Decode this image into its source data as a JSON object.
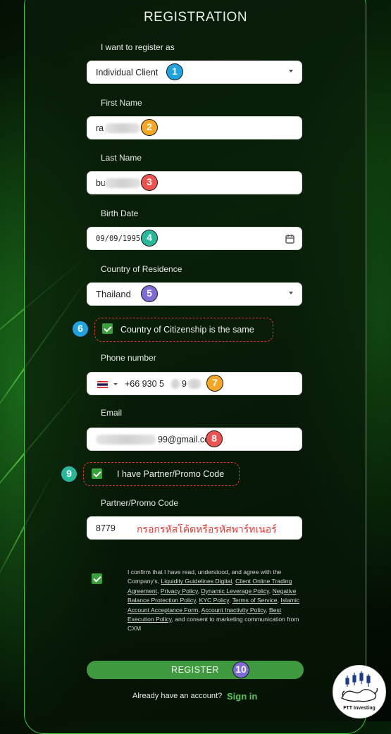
{
  "form": {
    "title": "REGISTRATION",
    "register_as": {
      "label": "I want to register as",
      "value": "Individual Client"
    },
    "first_name": {
      "label": "First Name",
      "value": "ra"
    },
    "last_name": {
      "label": "Last Name",
      "value": "bu"
    },
    "birth_date": {
      "label": "Birth Date",
      "value": "09/09/1995"
    },
    "country": {
      "label": "Country of Residence",
      "value": "Thailand"
    },
    "citizenship_same": {
      "label": "Country of Citizenship is the same",
      "checked": true
    },
    "phone": {
      "label": "Phone number",
      "value": "+66 930 5",
      "value_tail": "9"
    },
    "email": {
      "label": "Email",
      "value": "99@gmail.com"
    },
    "promo_toggle": {
      "label": "I have Partner/Promo Code",
      "checked": true
    },
    "promo": {
      "label": "Partner/Promo Code",
      "value": "8779",
      "hint": "กรอกรหัสโค้ดหรือรหัสพาร์ทเนอร์"
    },
    "consent": {
      "checked": true,
      "t1": "I confirm that I have read, understood, and agree with the Company's, ",
      "l1": "Liquidity Guidelines Digital",
      "s1": ", ",
      "l2": "Client Online Trading Agreement",
      "s2": ", ",
      "l3": "Privacy Policy",
      "s3": ", ",
      "l4": "Dynamic Leverage Policy",
      "s4": ", ",
      "l5": "Negative Balance Protection Policy",
      "s5": ", ",
      "l6": "KYC Policy",
      "s6": ", ",
      "l7": "Terms of Service",
      "s7": ", ",
      "l8": "Islamic Account Acceptance Form",
      "s8": ", ",
      "l9": "Account Inactivity Policy",
      "s9": ", ",
      "l10": "Best Execution Policy",
      "t2": ", and consent to marketing communication from CXM"
    },
    "register_button": "REGISTER",
    "already_text": "Already have an account?",
    "sign_in": "Sign in"
  },
  "badges": {
    "b1": "1",
    "b2": "2",
    "b3": "3",
    "b4": "4",
    "b5": "5",
    "b6": "6",
    "b7": "7",
    "b8": "8",
    "b9": "9",
    "b10": "10"
  },
  "colors": {
    "accent": "#3aa13a",
    "badge_blue": "#1fa3e0",
    "badge_orange": "#f5a623",
    "badge_red": "#ef5350",
    "badge_teal": "#26b99a",
    "badge_purple": "#7e6bd6",
    "hint_red": "#e53935"
  },
  "icons": [
    "calendar-icon",
    "thai-flag-icon",
    "chevron-down-icon",
    "checkbox-checked-icon"
  ],
  "watermark": {
    "text": "FTT Investing"
  }
}
